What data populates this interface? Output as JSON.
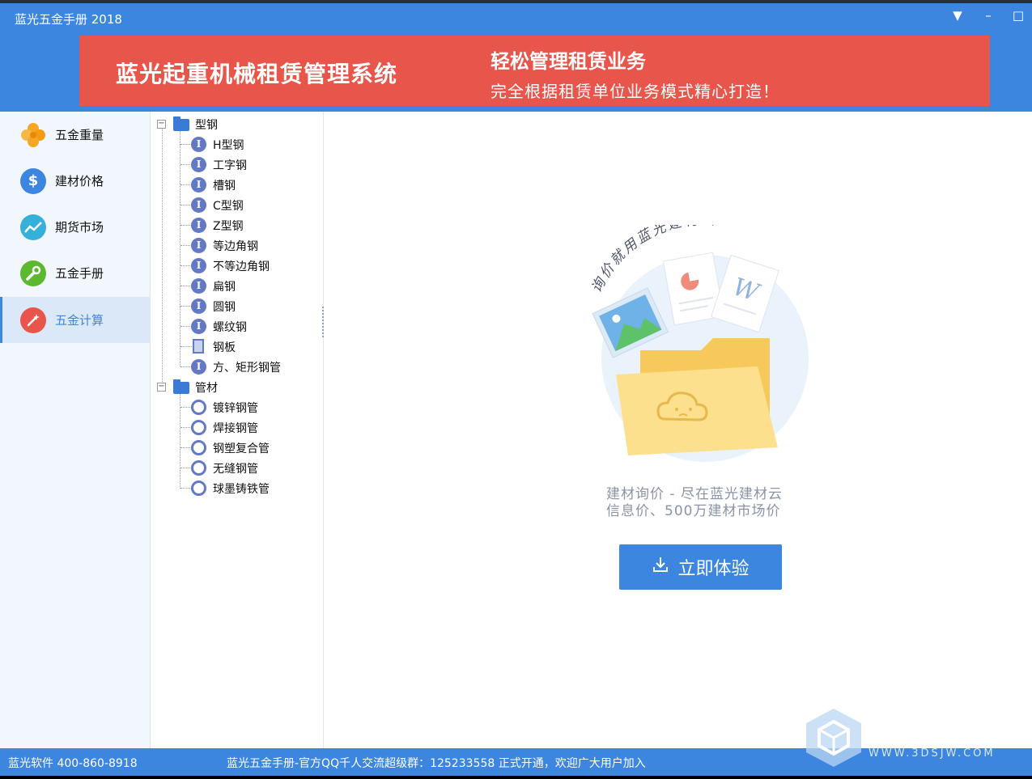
{
  "window": {
    "title": "蓝光五金手册 2018",
    "controls": [
      "▼",
      "–",
      "□"
    ]
  },
  "banner": {
    "main": "蓝光起重机械租赁管理系统",
    "heading": "轻松管理租赁业务",
    "sub": "完全根据租赁单位业务模式精心打造！"
  },
  "sidebar": {
    "items": [
      {
        "label": "五金重量",
        "icon": "clover-icon",
        "color": "#f5a623"
      },
      {
        "label": "建材价格",
        "icon": "dollar-icon",
        "color": "#3d86e0"
      },
      {
        "label": "期货市场",
        "icon": "trend-icon",
        "color": "#35b0d8"
      },
      {
        "label": "五金手册",
        "icon": "wrench-icon",
        "color": "#5cb82e"
      },
      {
        "label": "五金计算",
        "icon": "magic-wand-icon",
        "color": "#e8554a"
      }
    ],
    "active_index": 4
  },
  "tree": {
    "groups": [
      {
        "label": "型钢",
        "items": [
          "H型钢",
          "工字钢",
          "槽钢",
          "C型钢",
          "Z型钢",
          "等边角钢",
          "不等边角钢",
          "扁钢",
          "圆钢",
          "螺纹钢",
          "钢板",
          "方、矩形钢管"
        ]
      },
      {
        "label": "管材",
        "items": [
          "镀锌钢管",
          "焊接钢管",
          "钢塑复合管",
          "无缝钢管",
          "球墨铸铁管"
        ]
      }
    ]
  },
  "content": {
    "arc_text": "询价就用蓝光建材云~",
    "promo_line1": "建材询价 - 尽在蓝光建材云",
    "promo_line2": "信息价、500万建材市场价",
    "button_label": "立即体验"
  },
  "status": {
    "left": "蓝光软件 400-860-8918",
    "middle": "蓝光五金手册-官方QQ千人交流超级群：125233558 正式开通，欢迎广大用户加入"
  },
  "watermark": "WWW.3DSJW.COM"
}
